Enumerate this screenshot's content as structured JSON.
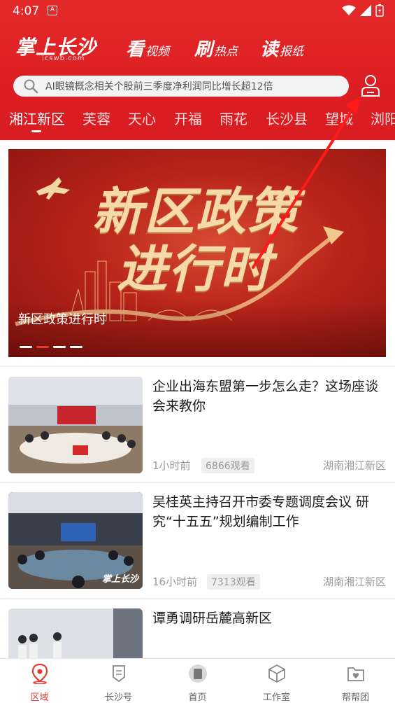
{
  "status": {
    "time": "4:07",
    "a_icon": "A"
  },
  "header": {
    "logo_main": "掌上长沙",
    "logo_sub": "icswb.com",
    "nav": [
      {
        "big": "看",
        "small": "视频"
      },
      {
        "big": "刷",
        "small": "热点"
      },
      {
        "big": "读",
        "small": "报纸"
      }
    ],
    "search_text": "AI眼镜概念相关个股前三季度净利润同比增长超12倍"
  },
  "channels": [
    "湘江新区",
    "芙蓉",
    "天心",
    "开福",
    "雨花",
    "长沙县",
    "望城",
    "浏阳"
  ],
  "banner": {
    "title_line1": "新区政策",
    "title_line2": "进行时",
    "caption": "新区政策进行时"
  },
  "news": [
    {
      "title": "企业出海东盟第一步怎么走？这场座谈会来教你",
      "time": "1小时前",
      "views": "6866观看",
      "source": "湖南湘江新区"
    },
    {
      "title": "吴桂英主持召开市委专题调度会议 研究“十五五”规划编制工作",
      "time": "16小时前",
      "views": "7313观看",
      "source": "湖南湘江新区"
    },
    {
      "title": "谭勇调研岳麓高新区",
      "time": "",
      "views": "",
      "source": ""
    }
  ],
  "thumb2_watermark": "掌上长沙",
  "tabs": [
    {
      "label": "区域",
      "icon": "location-pin-icon",
      "active": true
    },
    {
      "label": "长沙号",
      "icon": "changsha-account-icon",
      "active": false
    },
    {
      "label": "首页",
      "icon": "home-icon",
      "active": false
    },
    {
      "label": "工作室",
      "icon": "cube-icon",
      "active": false
    },
    {
      "label": "帮帮团",
      "icon": "folder-heart-icon",
      "active": false
    }
  ],
  "colors": {
    "brand_red": "#dc1f23",
    "accent_red": "#e23b2f"
  }
}
